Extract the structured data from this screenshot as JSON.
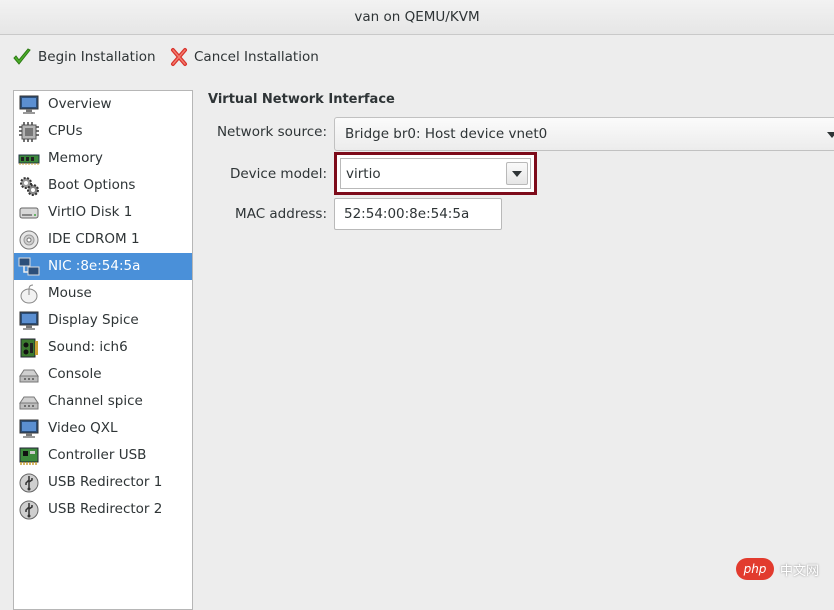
{
  "window": {
    "title": "van on QEMU/KVM"
  },
  "toolbar": {
    "begin_label": "Begin Installation",
    "cancel_label": "Cancel Installation"
  },
  "sidebar": {
    "selected_index": 6,
    "items": [
      {
        "label": "Overview",
        "icon": "monitor-icon"
      },
      {
        "label": "CPUs",
        "icon": "cpu-chip-icon"
      },
      {
        "label": "Memory",
        "icon": "memory-module-icon"
      },
      {
        "label": "Boot Options",
        "icon": "gears-icon"
      },
      {
        "label": "VirtIO Disk 1",
        "icon": "hard-disk-icon"
      },
      {
        "label": "IDE CDROM 1",
        "icon": "cdrom-icon"
      },
      {
        "label": "NIC :8e:54:5a",
        "icon": "network-icon"
      },
      {
        "label": "Mouse",
        "icon": "mouse-icon"
      },
      {
        "label": "Display Spice",
        "icon": "monitor-icon"
      },
      {
        "label": "Sound: ich6",
        "icon": "sound-card-icon"
      },
      {
        "label": "Console",
        "icon": "serial-port-icon"
      },
      {
        "label": "Channel spice",
        "icon": "serial-port-icon"
      },
      {
        "label": "Video QXL",
        "icon": "monitor-icon"
      },
      {
        "label": "Controller USB",
        "icon": "pci-card-icon"
      },
      {
        "label": "USB Redirector 1",
        "icon": "usb-icon"
      },
      {
        "label": "USB Redirector 2",
        "icon": "usb-icon"
      }
    ]
  },
  "details": {
    "section_title": "Virtual Network Interface",
    "network_source": {
      "label": "Network source:",
      "value": "Bridge br0: Host device vnet0"
    },
    "device_model": {
      "label": "Device model:",
      "value": "virtio"
    },
    "mac_address": {
      "label": "MAC address:",
      "value": "52:54:00:8e:54:5a"
    }
  },
  "watermark": {
    "logo_text": "php",
    "site_text": "中文网"
  },
  "colors": {
    "selection": "#4a90d9",
    "highlight_border": "#7d0b1a",
    "begin_check": "#4caf2a",
    "cancel_x": "#d9322b"
  }
}
